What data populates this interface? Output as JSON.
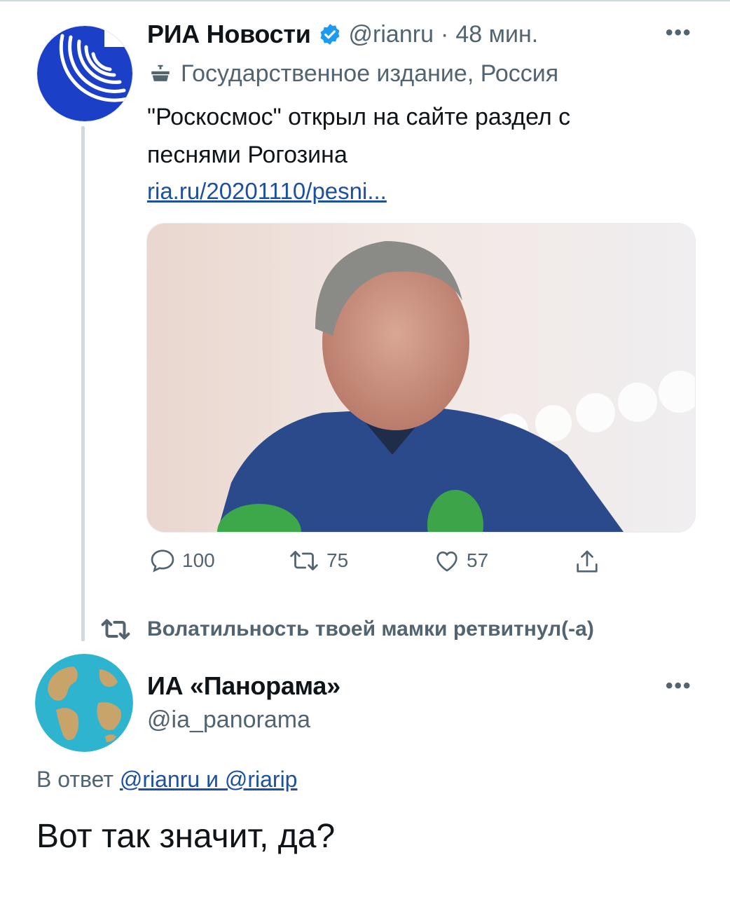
{
  "tweet1": {
    "author_name": "РИА Новости",
    "handle": "@rianru",
    "separator": "·",
    "time": "48 мин.",
    "more_icon": "more-dots-icon",
    "label_icon": "government-building-icon",
    "label": "Государственное издание, Россия",
    "text_line1": "\"Роскосмос\" открыл на сайте раздел с",
    "text_line2": "песнями Рогозина",
    "link": "ria.ru/20201110/pesni...",
    "actions": {
      "reply_count": "100",
      "retweet_count": "75",
      "like_count": "57"
    }
  },
  "retweet_banner": {
    "icon": "retweet-icon",
    "text": "Волатильность твоей мамки ретвитнул(-а)"
  },
  "tweet2": {
    "author_name": "ИА «Панорама»",
    "handle": "@ia_panorama",
    "reply_prefix": "В ответ",
    "reply_targets": "@rianru и @riarip",
    "text": "Вот так значит, да?"
  },
  "colors": {
    "link": "#1d4fa2",
    "verified": "#1d9bf0",
    "secondary_text": "#536471",
    "ria_blue": "#1b3fc7"
  }
}
